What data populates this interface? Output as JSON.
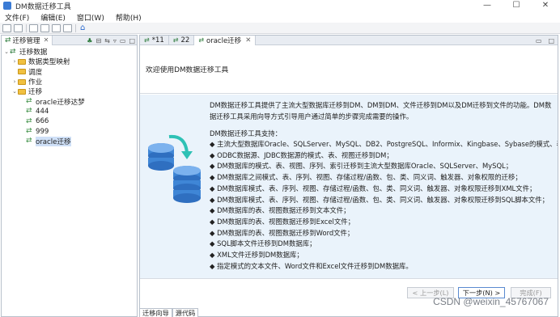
{
  "window": {
    "title": "DM数据迁移工具",
    "controls": [
      "—",
      "☐",
      "✕"
    ]
  },
  "menu": [
    "文件(F)",
    "编辑(E)",
    "窗口(W)",
    "帮助(H)"
  ],
  "left_panel": {
    "tab_label": "迁移管理",
    "tree": [
      {
        "label": "迁移数据",
        "level": 0,
        "type": "root",
        "expanded": true
      },
      {
        "label": "数据类型映射",
        "level": 1,
        "type": "folder",
        "expandable": true
      },
      {
        "label": "调度",
        "level": 1,
        "type": "folder",
        "expandable": false
      },
      {
        "label": "作业",
        "level": 1,
        "type": "folder",
        "expandable": true
      },
      {
        "label": "迁移",
        "level": 1,
        "type": "folder",
        "expanded": true
      },
      {
        "label": "oracle迁移达梦",
        "level": 2,
        "type": "job"
      },
      {
        "label": "444",
        "level": 2,
        "type": "job"
      },
      {
        "label": "666",
        "level": 2,
        "type": "job"
      },
      {
        "label": "999",
        "level": 2,
        "type": "job"
      },
      {
        "label": "oracle迁移",
        "level": 2,
        "type": "job",
        "selected": true
      }
    ]
  },
  "editor": {
    "tabs": [
      {
        "label": "*11",
        "active": false
      },
      {
        "label": "22",
        "active": false
      },
      {
        "label": "oracle迁移",
        "active": true
      }
    ],
    "wizard_title": "欢迎使用DM数据迁移工具",
    "intro": "DM数据迁移工具提供了主流大型数据库迁移到DM、DM到DM、文件迁移到DM以及DM迁移到文件的功能。DM数据迁移工具采用向导方式引导用户通过简单的步骤完成需要的操作。",
    "support_heading": "DM数据迁移工具支持：",
    "bullets": [
      "◆ 主流大型数据库Oracle、SQLServer、MySQL、DB2、PostgreSQL、Informix、Kingbase、Sybase的模式、表、视图、序列、索引迁移到DM；",
      "◆ ODBC数据源、JDBC数据源的模式、表、视图迁移到DM；",
      "◆ DM数据库的模式、表、视图、序列、索引迁移到主流大型数据库Oracle、SQLServer、MySQL；",
      "◆ DM数据库之间模式、表、序列、视图、存储过程/函数、包、类、同义词、触发器、对象权限的迁移；",
      "◆ DM数据库模式、表、序列、视图、存储过程/函数、包、类、同义词、触发器、对象权限迁移到XML文件；",
      "◆ DM数据库模式、表、序列、视图、存储过程/函数、包、类、同义词、触发器、对象权限迁移到SQL脚本文件；",
      "◆ DM数据库的表、视图数据迁移到文本文件；",
      "◆ DM数据库的表、视图数据迁移到Excel文件；",
      "◆ DM数据库的表、视图数据迁移到Word文件；",
      "◆ SQL脚本文件迁移到DM数据库；",
      "◆ XML文件迁移到DM数据库；",
      "◆ 指定模式的文本文件、Word文件和Excel文件迁移到DM数据库。"
    ],
    "buttons": {
      "back": "< 上一步(L)",
      "next": "下一步(N) >",
      "finish": "完成(F)"
    }
  },
  "bottom_tabs": [
    "迁移向导",
    "源代码"
  ],
  "watermark": "CSDN @weixin_45767067"
}
